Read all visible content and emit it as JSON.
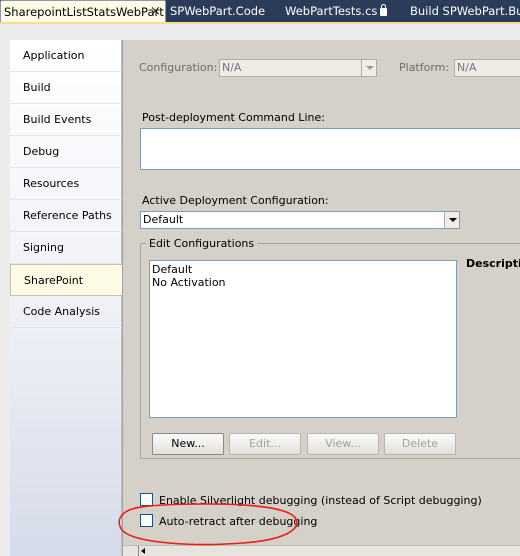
{
  "tabs": [
    {
      "label": "SharepointListStatsWebPart",
      "close": "×"
    },
    {
      "label": "SPWebPart.Code"
    },
    {
      "label": "WebPartTests.cs"
    },
    {
      "label": "Build SPWebPart.Bui...p"
    }
  ],
  "nav": {
    "items": [
      {
        "label": "Application"
      },
      {
        "label": "Build"
      },
      {
        "label": "Build Events"
      },
      {
        "label": "Debug"
      },
      {
        "label": "Resources"
      },
      {
        "label": "Reference Paths"
      },
      {
        "label": "Signing"
      },
      {
        "label": "SharePoint"
      },
      {
        "label": "Code Analysis"
      }
    ],
    "active": "SharePoint"
  },
  "config": {
    "configuration_label": "Configuration:",
    "configuration_value": "N/A",
    "platform_label": "Platform:",
    "platform_value": "N/A"
  },
  "post_deploy": {
    "label": "Post-deployment Command Line:",
    "value": ""
  },
  "deployment": {
    "label": "Active Deployment Configuration:",
    "value": "Default"
  },
  "edit_configs": {
    "title": "Edit Configurations",
    "items": [
      "Default",
      "No Activation"
    ],
    "description_label": "Descriptio",
    "buttons": {
      "new": "New...",
      "edit": "Edit...",
      "view": "View...",
      "delete": "Delete"
    }
  },
  "options": {
    "silverlight_label": "Enable Silverlight debugging (instead of Script debugging)",
    "silverlight_checked": false,
    "autoretract_label": "Auto-retract after debugging",
    "autoretract_checked": false
  },
  "colors": {
    "annotation": "#e8201c",
    "active_tab": "#fdfbe6",
    "tab_strip": "#2b3c59"
  }
}
